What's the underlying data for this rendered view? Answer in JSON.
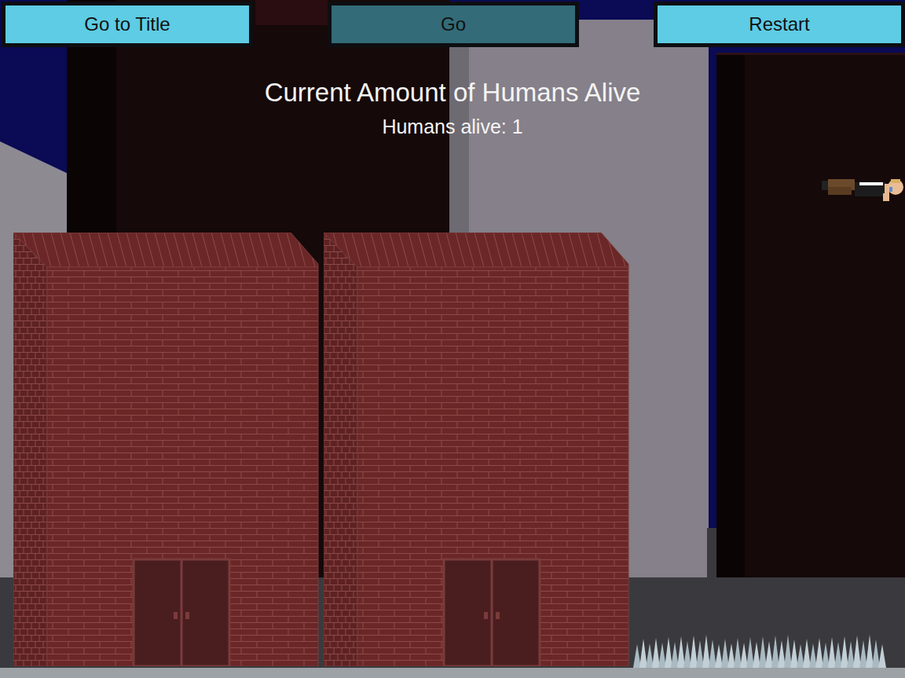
{
  "toolbar": {
    "buttons": [
      {
        "label": "Go to Title",
        "selected": false
      },
      {
        "label": "Go",
        "selected": true
      },
      {
        "label": "Restart",
        "selected": false
      }
    ]
  },
  "hud": {
    "title": "Current Amount of Humans Alive",
    "counter": "Humans alive: 1"
  }
}
